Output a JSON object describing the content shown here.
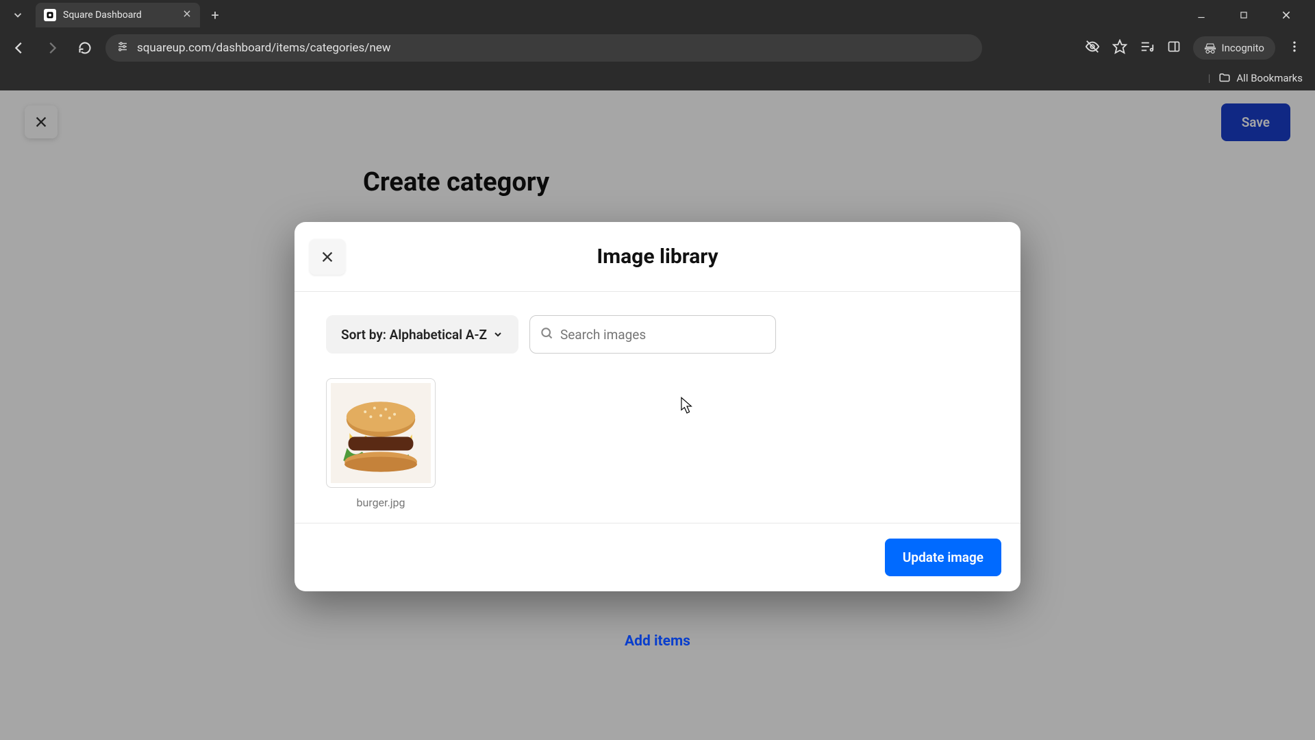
{
  "browser": {
    "tab_title": "Square Dashboard",
    "url": "squareup.com/dashboard/items/categories/new",
    "incognito_label": "Incognito",
    "all_bookmarks_label": "All Bookmarks"
  },
  "page": {
    "close_aria": "Close",
    "save_label": "Save",
    "bg_heading": "Create category",
    "add_items_label": "Add items"
  },
  "modal": {
    "title": "Image library",
    "sort_label": "Sort by: Alphabetical A-Z",
    "search_placeholder": "Search images",
    "update_label": "Update image",
    "images": [
      {
        "filename": "burger.jpg"
      }
    ]
  }
}
